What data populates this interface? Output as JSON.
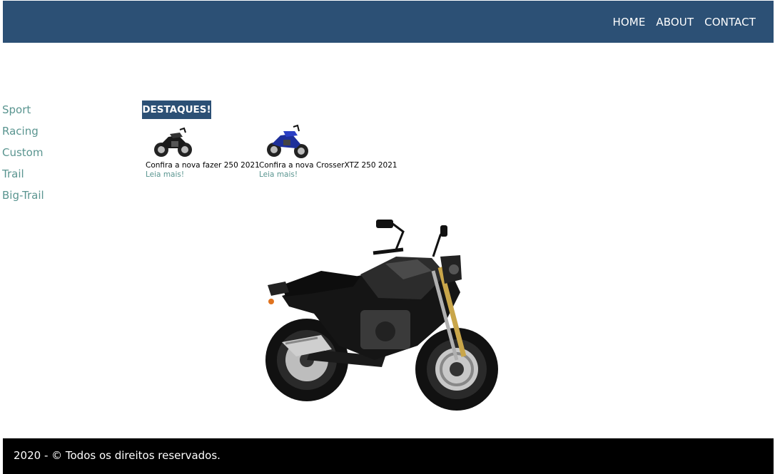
{
  "nav": {
    "home": "HOME",
    "about": "ABOUT",
    "contact": "CONTACT"
  },
  "sidebar": {
    "items": [
      {
        "label": "Sport"
      },
      {
        "label": "Racing"
      },
      {
        "label": "Custom"
      },
      {
        "label": "Trail"
      },
      {
        "label": "Big-Trail"
      }
    ]
  },
  "highlights": {
    "title": "DESTAQUES!",
    "cards": [
      {
        "caption": "Confira a nova fazer 250 2021",
        "link": "Leia mais!"
      },
      {
        "caption": "Confira a nova CrosserXTZ 250 2021",
        "link": "Leia mais!"
      }
    ]
  },
  "footer": {
    "text": "2020 - © Todos os direitos reservados."
  },
  "colors": {
    "header_bg": "#2c5075",
    "link": "#5a9590",
    "footer_bg": "#000000"
  }
}
